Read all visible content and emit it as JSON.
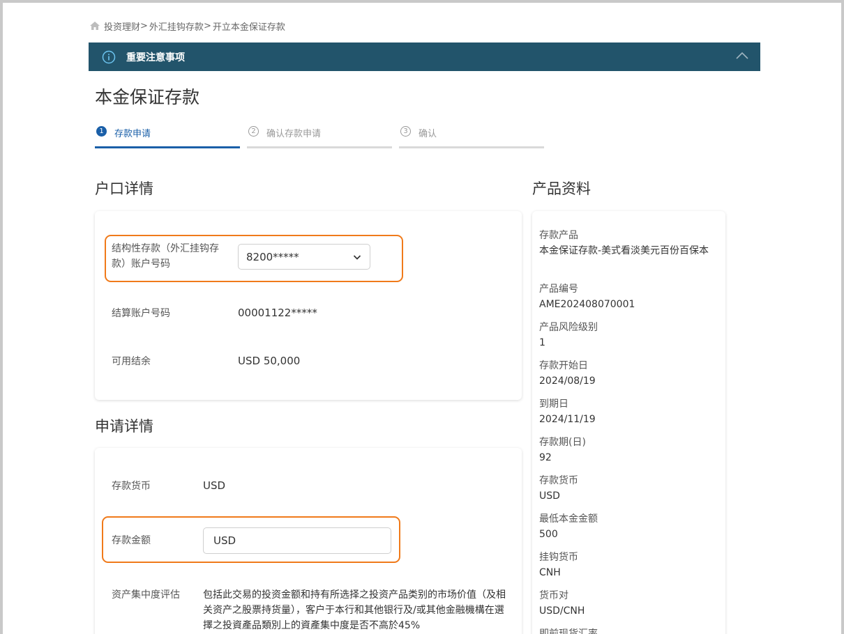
{
  "breadcrumb": {
    "items": [
      "投资理财",
      "外汇挂钩存款",
      "开立本金保证存款"
    ],
    "separator": ">"
  },
  "notice": {
    "title": "重要注意事项"
  },
  "page": {
    "title": "本金保证存款"
  },
  "steps": [
    {
      "number": "1",
      "label": "存款申请",
      "active": true
    },
    {
      "number": "2",
      "label": "确认存款申请",
      "active": false
    },
    {
      "number": "3",
      "label": "确认",
      "active": false
    }
  ],
  "account_section": {
    "title": "户口详情",
    "structured_label": "结构性存款（外汇挂钩存款）账户号码",
    "structured_value": "8200*****",
    "settlement_label": "结算账户号码",
    "settlement_value": "00001122*****",
    "balance_label": "可用结余",
    "balance_value": "USD 50,000"
  },
  "application_section": {
    "title": "申请详情",
    "currency_label": "存款货币",
    "currency_value": "USD",
    "amount_label": "存款金额",
    "amount_value": "USD",
    "concentration_label": "资产集中度评估",
    "concentration_text": "包括此交易的投资金额和持有所选择之投资产品类别的市场价值（及相关资产之股票持货量），客户于本行和其他银行及/或其他金融機構在選擇之投資產品類別上的資產集中度是否不高於45%"
  },
  "product_section": {
    "title": "产品资料",
    "items": [
      {
        "label": "存款产品",
        "value": "本金保证存款-美式看淡美元百份百保本"
      },
      {
        "label": "产品编号",
        "value": "AME202408070001"
      },
      {
        "label": "产品风险级别",
        "value": "1"
      },
      {
        "label": "存款开始日",
        "value": "2024/08/19"
      },
      {
        "label": "到期日",
        "value": "2024/11/19"
      },
      {
        "label": "存款期(日)",
        "value": "92"
      },
      {
        "label": "存款货币",
        "value": "USD"
      },
      {
        "label": "最低本金金额",
        "value": "500"
      },
      {
        "label": "挂钩货币",
        "value": "CNH"
      },
      {
        "label": "货币对",
        "value": "USD/CNH"
      },
      {
        "label": "即前现货汇率",
        "value": ""
      }
    ]
  },
  "colors": {
    "notice_bar": "#22546b",
    "active_step": "#1a5fa8",
    "highlight": "#f07a1a"
  }
}
